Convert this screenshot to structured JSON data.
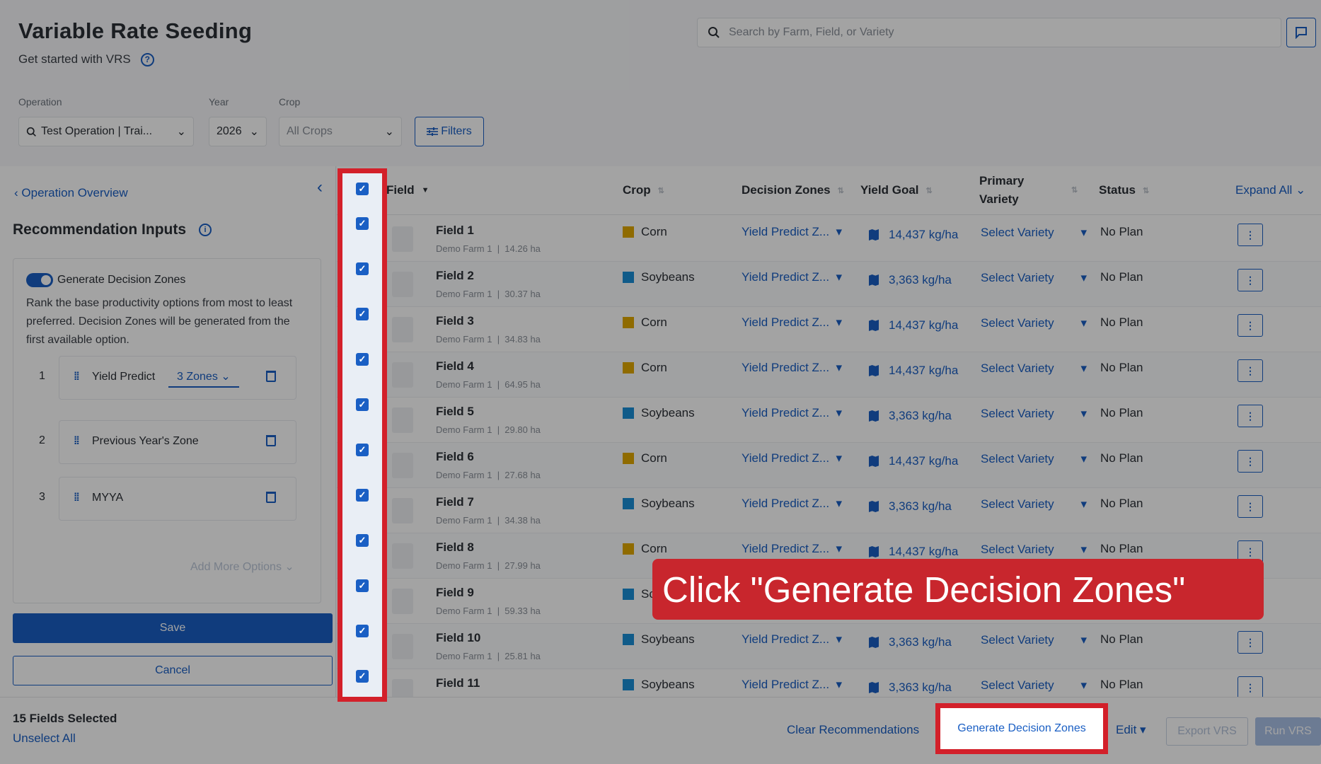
{
  "header": {
    "title": "Variable Rate Seeding",
    "subtitle": "Get started with VRS",
    "search_placeholder": "Search by Farm, Field, or Variety"
  },
  "filters": {
    "operation_label": "Operation",
    "operation_value": "Test Operation | Trai...",
    "year_label": "Year",
    "year_value": "2026",
    "crop_label": "Crop",
    "crop_value": "All Crops",
    "filters_button": "Filters"
  },
  "left_panel": {
    "back_link": "Operation Overview",
    "section_title": "Recommendation Inputs",
    "toggle_label": "Generate Decision Zones",
    "description": "Rank the base productivity options from most to least preferred. Decision Zones will be generated from the first available option.",
    "options": [
      {
        "rank": "1",
        "label": "Yield Predict",
        "zones": "3 Zones"
      },
      {
        "rank": "2",
        "label": "Previous Year's Zone",
        "zones": ""
      },
      {
        "rank": "3",
        "label": "MYYA",
        "zones": ""
      }
    ],
    "add_more": "Add More Options",
    "save": "Save",
    "cancel": "Cancel"
  },
  "table": {
    "columns": {
      "field": "Field",
      "crop": "Crop",
      "decision_zones": "Decision Zones",
      "yield_goal": "Yield Goal",
      "primary_variety": "Primary Variety",
      "status": "Status",
      "expand_all": "Expand All"
    },
    "rows": [
      {
        "name": "Field 1",
        "farm": "Demo Farm 1",
        "area": "14.26 ha",
        "crop": "Corn",
        "crop_color": "#e0a800",
        "dz": "Yield Predict Z...",
        "yield": "14,437 kg/ha",
        "variety": "Select Variety",
        "status": "No Plan"
      },
      {
        "name": "Field 2",
        "farm": "Demo Farm 1",
        "area": "30.37 ha",
        "crop": "Soybeans",
        "crop_color": "#1a8fd6",
        "dz": "Yield Predict Z...",
        "yield": "3,363 kg/ha",
        "variety": "Select Variety",
        "status": "No Plan"
      },
      {
        "name": "Field 3",
        "farm": "Demo Farm 1",
        "area": "34.83 ha",
        "crop": "Corn",
        "crop_color": "#e0a800",
        "dz": "Yield Predict Z...",
        "yield": "14,437 kg/ha",
        "variety": "Select Variety",
        "status": "No Plan"
      },
      {
        "name": "Field 4",
        "farm": "Demo Farm 1",
        "area": "64.95 ha",
        "crop": "Corn",
        "crop_color": "#e0a800",
        "dz": "Yield Predict Z...",
        "yield": "14,437 kg/ha",
        "variety": "Select Variety",
        "status": "No Plan"
      },
      {
        "name": "Field 5",
        "farm": "Demo Farm 1",
        "area": "29.80 ha",
        "crop": "Soybeans",
        "crop_color": "#1a8fd6",
        "dz": "Yield Predict Z...",
        "yield": "3,363 kg/ha",
        "variety": "Select Variety",
        "status": "No Plan"
      },
      {
        "name": "Field 6",
        "farm": "Demo Farm 1",
        "area": "27.68 ha",
        "crop": "Corn",
        "crop_color": "#e0a800",
        "dz": "Yield Predict Z...",
        "yield": "14,437 kg/ha",
        "variety": "Select Variety",
        "status": "No Plan"
      },
      {
        "name": "Field 7",
        "farm": "Demo Farm 1",
        "area": "34.38 ha",
        "crop": "Soybeans",
        "crop_color": "#1a8fd6",
        "dz": "Yield Predict Z...",
        "yield": "3,363 kg/ha",
        "variety": "Select Variety",
        "status": "No Plan"
      },
      {
        "name": "Field 8",
        "farm": "Demo Farm 1",
        "area": "27.99 ha",
        "crop": "Corn",
        "crop_color": "#e0a800",
        "dz": "Yield Predict Z...",
        "yield": "14,437 kg/ha",
        "variety": "Select Variety",
        "status": "No Plan"
      },
      {
        "name": "Field 9",
        "farm": "Demo Farm 1",
        "area": "59.33 ha",
        "crop": "Sc",
        "crop_color": "#1a8fd6",
        "dz": "",
        "yield": "",
        "variety": "",
        "status": ""
      },
      {
        "name": "Field 10",
        "farm": "Demo Farm 1",
        "area": "25.81 ha",
        "crop": "Soybeans",
        "crop_color": "#1a8fd6",
        "dz": "Yield Predict Z...",
        "yield": "3,363 kg/ha",
        "variety": "Select Variety",
        "status": "No Plan"
      },
      {
        "name": "Field 11",
        "farm": "",
        "area": "",
        "crop": "Soybeans",
        "crop_color": "#1a8fd6",
        "dz": "Yield Predict Z...",
        "yield": "3,363 kg/ha",
        "variety": "Select Variety",
        "status": "No Plan"
      }
    ]
  },
  "bottom_bar": {
    "selected_count": "15 Fields Selected",
    "unselect_all": "Unselect All",
    "clear_recommendations": "Clear Recommendations",
    "generate_zones": "Generate Decision Zones",
    "edit": "Edit",
    "export_vrs": "Export VRS",
    "run_vrs": "Run VRS"
  },
  "callout": {
    "text": "Click \"Generate Decision Zones\""
  },
  "colors": {
    "accent": "#1a5fc4",
    "highlight": "#d3202a",
    "corn": "#e0a800",
    "soybeans": "#1a8fd6"
  }
}
